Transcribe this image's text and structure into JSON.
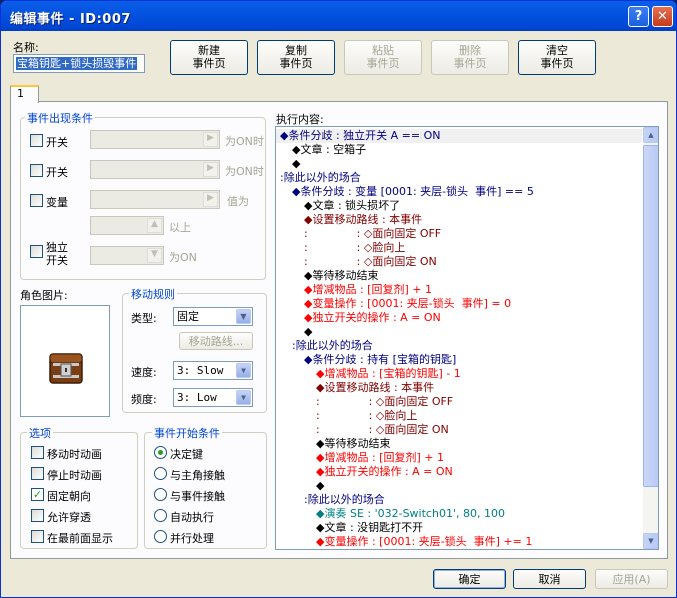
{
  "window": {
    "title": "编辑事件 - ID:007",
    "help_glyph": "?",
    "close_glyph": "✕"
  },
  "name": {
    "label": "名称:",
    "value": "宝箱钥匙+锁头损毁事件"
  },
  "toolbar": {
    "new_page": [
      "新建",
      "事件页"
    ],
    "copy_page": [
      "复制",
      "事件页"
    ],
    "paste_page": [
      "粘贴",
      "事件页"
    ],
    "delete_page": [
      "删除",
      "事件页"
    ],
    "clear_page": [
      "清空",
      "事件页"
    ]
  },
  "tabs": [
    {
      "label": "1"
    }
  ],
  "conditions": {
    "title": "事件出现条件",
    "switch1": {
      "label": "开关",
      "suffix": "为ON时"
    },
    "switch2": {
      "label": "开关",
      "suffix": "为ON时"
    },
    "variable": {
      "label": "变量",
      "suffix": "值为",
      "suffix2": "以上"
    },
    "self_switch": {
      "label": [
        "独立",
        "开关"
      ],
      "suffix": "为ON"
    }
  },
  "graphic": {
    "label": "角色图片:",
    "icon": "treasure-chest-icon"
  },
  "movement": {
    "title": "移动规则",
    "type": {
      "label": "类型:",
      "value": "固定"
    },
    "route_button": "移动路线...",
    "speed": {
      "label": "速度:",
      "value": "3: Slow"
    },
    "freq": {
      "label": "频度:",
      "value": "3: Low"
    }
  },
  "options": {
    "title": "选项",
    "items": [
      {
        "label": "移动时动画",
        "checked": false
      },
      {
        "label": "停止时动画",
        "checked": false
      },
      {
        "label": "固定朝向",
        "checked": true
      },
      {
        "label": "允许穿透",
        "checked": false
      },
      {
        "label": "在最前面显示",
        "checked": false
      }
    ]
  },
  "trigger": {
    "title": "事件开始条件",
    "items": [
      {
        "label": "决定键",
        "selected": true
      },
      {
        "label": "与主角接触",
        "selected": false
      },
      {
        "label": "与事件接触",
        "selected": false
      },
      {
        "label": "自动执行",
        "selected": false
      },
      {
        "label": "并行处理",
        "selected": false
      }
    ]
  },
  "exec": {
    "label": "执行内容:",
    "lines": [
      {
        "text": "◆条件分歧 : 独立开关 A == ON",
        "color": "#000080",
        "indent": 0
      },
      {
        "text": "◆文章 : 空箱子",
        "color": "#000000",
        "indent": 1
      },
      {
        "text": "◆",
        "color": "#000000",
        "indent": 1
      },
      {
        "text": ":除此以外的场合",
        "color": "#000080",
        "indent": 0
      },
      {
        "text": "◆条件分歧 : 变量 [0001: 夹层-锁头  事件] == 5",
        "color": "#000080",
        "indent": 1
      },
      {
        "text": "◆文章 : 锁头损坏了",
        "color": "#000000",
        "indent": 2
      },
      {
        "text": "◆设置移动路线 : 本事件",
        "color": "#800000",
        "indent": 2
      },
      {
        "text": ":              : ◇面向固定 OFF",
        "color": "#800000",
        "indent": 2
      },
      {
        "text": ":              : ◇脸向上",
        "color": "#800000",
        "indent": 2
      },
      {
        "text": ":              : ◇面向固定 ON",
        "color": "#800000",
        "indent": 2
      },
      {
        "text": "◆等待移动结束",
        "color": "#000000",
        "indent": 2
      },
      {
        "text": "◆增减物品 : [回复剂] + 1",
        "color": "#ff0000",
        "indent": 2
      },
      {
        "text": "◆变量操作 : [0001: 夹层-锁头  事件] = 0",
        "color": "#ff0000",
        "indent": 2
      },
      {
        "text": "◆独立开关的操作 : A = ON",
        "color": "#ff0000",
        "indent": 2
      },
      {
        "text": "◆",
        "color": "#000000",
        "indent": 2
      },
      {
        "text": ":除此以外的场合",
        "color": "#000080",
        "indent": 1
      },
      {
        "text": "◆条件分歧 : 持有 [宝箱的钥匙]",
        "color": "#000080",
        "indent": 2
      },
      {
        "text": "◆增减物品 : [宝箱的钥匙] - 1",
        "color": "#ff0000",
        "indent": 3
      },
      {
        "text": "◆设置移动路线 : 本事件",
        "color": "#800000",
        "indent": 3
      },
      {
        "text": ":              : ◇面向固定 OFF",
        "color": "#800000",
        "indent": 3
      },
      {
        "text": ":              : ◇脸向上",
        "color": "#800000",
        "indent": 3
      },
      {
        "text": ":              : ◇面向固定 ON",
        "color": "#800000",
        "indent": 3
      },
      {
        "text": "◆等待移动结束",
        "color": "#000000",
        "indent": 3
      },
      {
        "text": "◆增减物品 : [回复剂] + 1",
        "color": "#ff0000",
        "indent": 3
      },
      {
        "text": "◆独立开关的操作 : A = ON",
        "color": "#ff0000",
        "indent": 3
      },
      {
        "text": "◆",
        "color": "#000000",
        "indent": 3
      },
      {
        "text": ":除此以外的场合",
        "color": "#000080",
        "indent": 2
      },
      {
        "text": "◆演奏 SE : '032-Switch01', 80, 100",
        "color": "#008080",
        "indent": 3
      },
      {
        "text": "◆文章 : 没钥匙打不开",
        "color": "#000000",
        "indent": 3
      },
      {
        "text": "◆变量操作 : [0001: 夹层-锁头  事件] += 1",
        "color": "#ff0000",
        "indent": 3
      }
    ]
  },
  "footer": {
    "ok": "确定",
    "cancel": "取消",
    "apply": "应用(A)"
  }
}
